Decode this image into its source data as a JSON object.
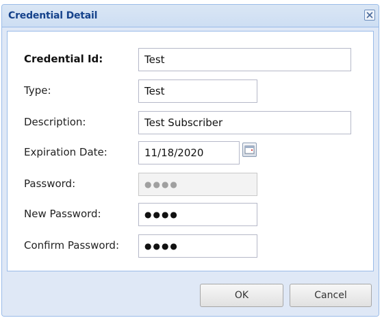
{
  "dialog": {
    "title": "Credential Detail",
    "close_icon": "close-icon"
  },
  "form": {
    "credential_id": {
      "label": "Credential Id:",
      "value": "Test"
    },
    "type": {
      "label": "Type:",
      "value": "Test"
    },
    "description": {
      "label": "Description:",
      "value": "Test Subscriber"
    },
    "expiration_date": {
      "label": "Expiration Date:",
      "value": "11/18/2020",
      "picker_icon": "calendar-icon"
    },
    "password": {
      "label": "Password:",
      "value": "●●●●",
      "disabled": true
    },
    "new_password": {
      "label": "New Password:",
      "value": "●●●●"
    },
    "confirm_password": {
      "label": "Confirm Password:",
      "value": "●●●●"
    }
  },
  "buttons": {
    "ok": "OK",
    "cancel": "Cancel"
  },
  "colors": {
    "title_text": "#15428b",
    "frame_border": "#99bbe8",
    "frame_background": "#dfe8f6"
  }
}
